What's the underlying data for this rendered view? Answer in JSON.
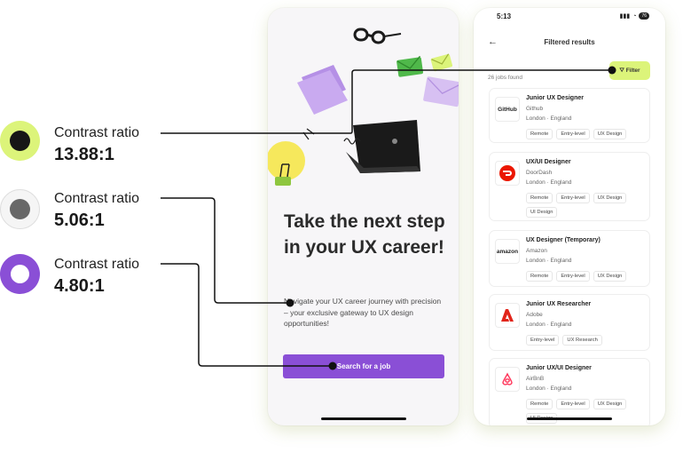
{
  "legend": [
    {
      "label": "Contrast ratio",
      "value": "13.88:1",
      "outer_color": "#dcf47a",
      "inner_color": "#161616"
    },
    {
      "label": "Contrast ratio",
      "value": "5.06:1",
      "outer_color": "#f2f2f2",
      "inner_color": "#686868"
    },
    {
      "label": "Contrast ratio",
      "value": "4.80:1",
      "outer_color": "#8a4fd6",
      "inner_color": "#ffffff"
    }
  ],
  "phone1": {
    "headline": "Take the next step in your UX career!",
    "subtext": "Navigate your UX career journey with precision – your exclusive gateway to UX design opportunities!",
    "cta_label": "Search for a job"
  },
  "phone2": {
    "status_time": "5:13",
    "battery": "76",
    "title": "Filtered results",
    "filter_label": "Filter",
    "jobs_count": "26 jobs found",
    "jobs": [
      {
        "title": "Junior UX Designer",
        "company": "Github",
        "location": "London · England",
        "logo_text": "GitHub",
        "tags": [
          "Remote",
          "Entry-level",
          "UX Design"
        ]
      },
      {
        "title": "UX/UI Designer",
        "company": "DoorDash",
        "location": "London · England",
        "logo_text": "",
        "tags": [
          "Remote",
          "Entry-level",
          "UX Design",
          "UI Design"
        ]
      },
      {
        "title": "UX Designer (Temporary)",
        "company": "Amazon",
        "location": "London · England",
        "logo_text": "amazon",
        "tags": [
          "Remote",
          "Entry-level",
          "UX Design"
        ]
      },
      {
        "title": "Junior UX Researcher",
        "company": "Adobe",
        "location": "London · England",
        "logo_text": "",
        "tags": [
          "Entry-level",
          "UX Research"
        ]
      },
      {
        "title": "Junior UX/UI Designer",
        "company": "AirBnB",
        "location": "London · England",
        "logo_text": "",
        "tags": [
          "Remote",
          "Entry-level",
          "UX Design",
          "UI Design"
        ]
      }
    ]
  },
  "colors": {
    "accent_purple": "#8a4fd6",
    "accent_lime": "#dcf47a",
    "dark": "#161616"
  }
}
